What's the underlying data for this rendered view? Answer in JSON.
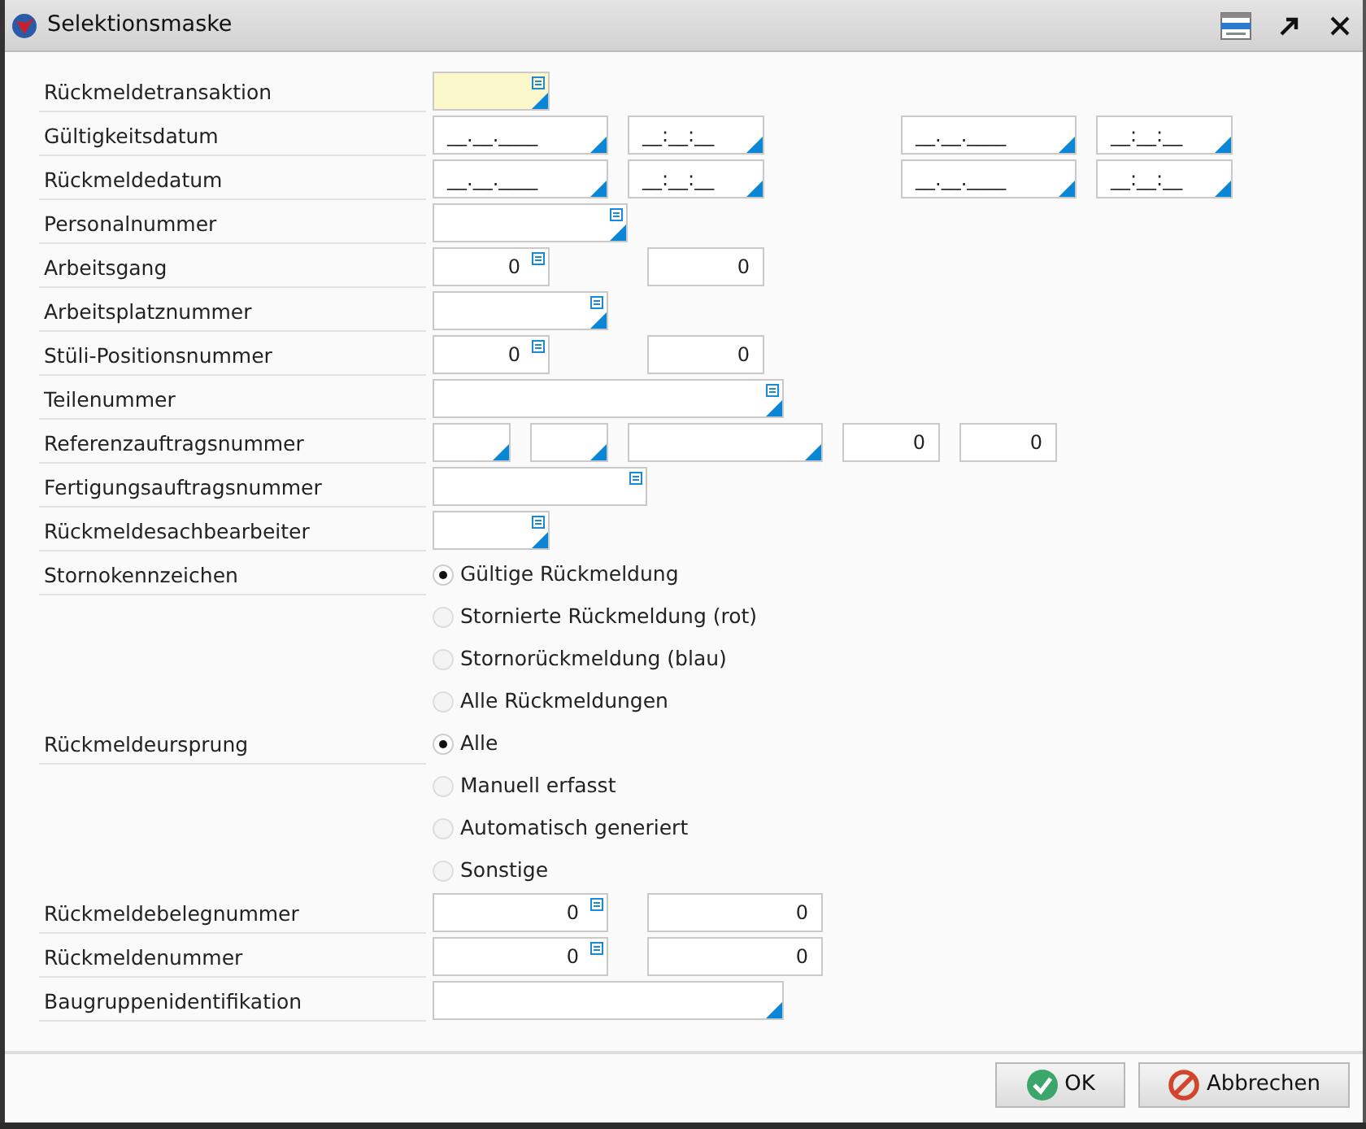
{
  "window": {
    "title": "Selektionsmaske"
  },
  "rows": [
    {
      "kind": "fields",
      "label": "Rückmeldetransaktion",
      "fields": [
        {
          "kind": "text",
          "lookup": true,
          "dropdown": true,
          "highlighted": true
        }
      ]
    },
    {
      "kind": "fields",
      "label": "Gültigkeitsdatum",
      "fields": [
        {
          "kind": "text",
          "value": "__.__.____",
          "dropdown": true
        },
        {
          "kind": "text",
          "value": "__:__:__",
          "dropdown": true
        },
        {
          "kind": "text",
          "value": "__.__.____",
          "dropdown": true
        },
        {
          "kind": "text",
          "value": "__:__:__",
          "dropdown": true
        }
      ]
    },
    {
      "kind": "fields",
      "label": "Rückmeldedatum",
      "fields": [
        {
          "kind": "text",
          "value": "__.__.____",
          "dropdown": true
        },
        {
          "kind": "text",
          "value": "__:__:__",
          "dropdown": true
        },
        {
          "kind": "text",
          "value": "__.__.____",
          "dropdown": true
        },
        {
          "kind": "text",
          "value": "__:__:__",
          "dropdown": true
        }
      ]
    },
    {
      "kind": "fields",
      "label": "Personalnummer",
      "fields": [
        {
          "kind": "text",
          "lookup": true,
          "dropdown": true
        }
      ]
    },
    {
      "kind": "fields",
      "label": "Arbeitsgang",
      "fields": [
        {
          "kind": "number",
          "value": "0",
          "lookup": true
        },
        {
          "kind": "number",
          "value": "0"
        }
      ]
    },
    {
      "kind": "fields",
      "label": "Arbeitsplatznummer",
      "fields": [
        {
          "kind": "text",
          "lookup": true,
          "dropdown": true
        }
      ]
    },
    {
      "kind": "fields",
      "label": "Stüli-Positionsnummer",
      "fields": [
        {
          "kind": "number",
          "value": "0",
          "lookup": true
        },
        {
          "kind": "number",
          "value": "0"
        }
      ]
    },
    {
      "kind": "fields",
      "label": "Teilenummer",
      "fields": [
        {
          "kind": "text",
          "lookup": true,
          "dropdown": true
        }
      ]
    },
    {
      "kind": "fields",
      "label": "Referenzauftragsnummer",
      "fields": [
        {
          "kind": "text",
          "dropdown": true
        },
        {
          "kind": "text",
          "dropdown": true
        },
        {
          "kind": "text",
          "dropdown": true
        },
        {
          "kind": "number",
          "value": "0"
        },
        {
          "kind": "number",
          "value": "0"
        }
      ]
    },
    {
      "kind": "fields",
      "label": "Fertigungsauftragsnummer",
      "fields": [
        {
          "kind": "text",
          "lookup": true
        }
      ]
    },
    {
      "kind": "fields",
      "label": "Rückmeldesachbearbeiter",
      "fields": [
        {
          "kind": "text",
          "lookup": true,
          "dropdown": true
        }
      ]
    },
    {
      "kind": "radios",
      "label": "Stornokennzeichen",
      "options": [
        {
          "label": "Gültige Rückmeldung",
          "selected": true
        },
        {
          "label": "Stornierte Rückmeldung (rot)",
          "selected": false
        },
        {
          "label": "Stornorückmeldung (blau)",
          "selected": false
        },
        {
          "label": "Alle Rückmeldungen",
          "selected": false
        }
      ]
    },
    {
      "kind": "radios",
      "label": "Rückmeldeursprung",
      "options": [
        {
          "label": "Alle",
          "selected": true
        },
        {
          "label": "Manuell erfasst",
          "selected": false
        },
        {
          "label": "Automatisch generiert",
          "selected": false
        },
        {
          "label": "Sonstige",
          "selected": false
        }
      ]
    },
    {
      "kind": "fields",
      "label": "Rückmeldebelegnummer",
      "fields": [
        {
          "kind": "number",
          "value": "0",
          "lookup": true
        },
        {
          "kind": "number",
          "value": "0"
        }
      ]
    },
    {
      "kind": "fields",
      "label": "Rückmeldenummer",
      "fields": [
        {
          "kind": "number",
          "value": "0",
          "lookup": true
        },
        {
          "kind": "number",
          "value": "0"
        }
      ]
    },
    {
      "kind": "fields",
      "label": "Baugruppenidentifikation",
      "fields": [
        {
          "kind": "text",
          "dropdown": true
        }
      ]
    }
  ],
  "buttons": [
    {
      "kind": "ok",
      "label": "OK"
    },
    {
      "kind": "cancel",
      "label": "Abbrechen"
    }
  ]
}
